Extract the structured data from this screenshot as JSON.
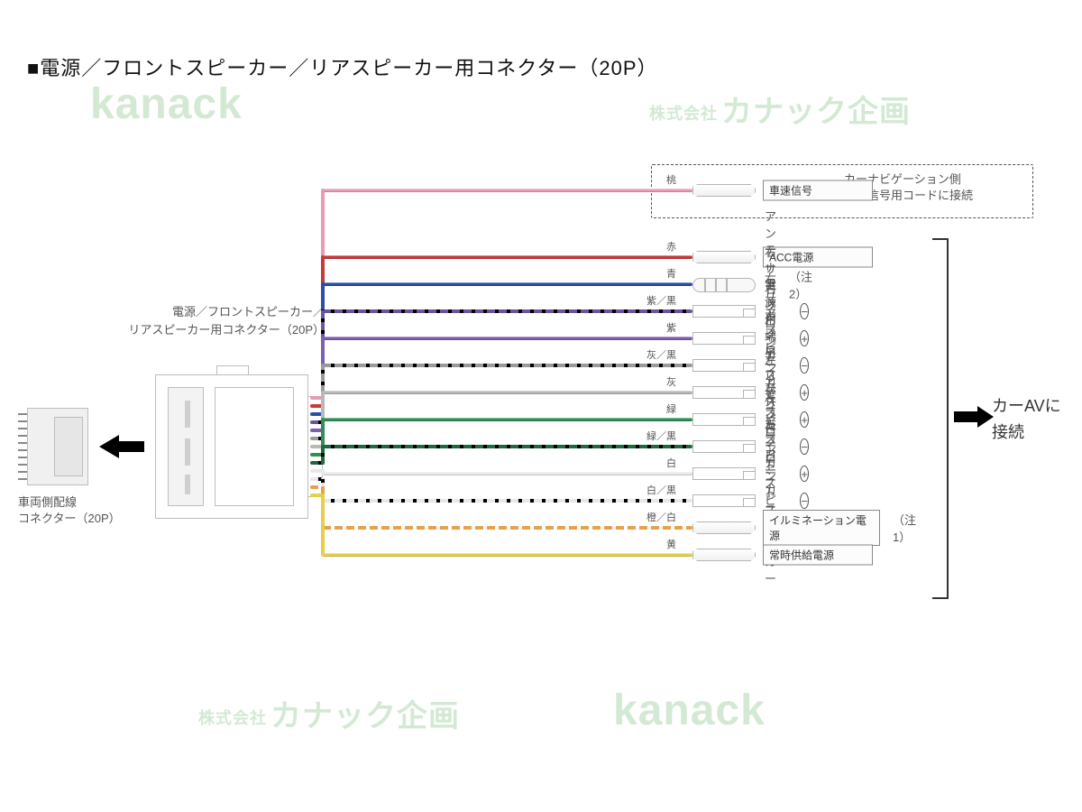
{
  "title": "■電源／フロントスピーカー／リアスピーカー用コネクター（20P）",
  "left": {
    "vehicle_conn_label_1": "車両側配線",
    "vehicle_conn_label_2": "コネクター（20P）",
    "main_conn_label_1": "電源／フロントスピーカー／",
    "main_conn_label_2": "リアスピーカー用コネクター（20P）"
  },
  "speed_signal": {
    "label": "車速信号",
    "dest_1": "カーナビゲーション側",
    "dest_2": "車速信号用コードに接続"
  },
  "right_group": {
    "line1": "カーAVに",
    "line2": "接続"
  },
  "notes": {
    "n1": "（注1）",
    "n2": "（注2）"
  },
  "wires": [
    {
      "id": "w_pink",
      "color_label": "桃",
      "css": "#e89ab6",
      "stripe": null,
      "plug": "A",
      "label_box": true,
      "label": "車速信号",
      "polarity": null,
      "note": null,
      "gap": true
    },
    {
      "id": "w_red",
      "color_label": "赤",
      "css": "#c63a3a",
      "stripe": null,
      "plug": "A",
      "label_box": true,
      "label": "ACC電源",
      "polarity": null,
      "note": null
    },
    {
      "id": "w_blue",
      "color_label": "青",
      "css": "#2b4ea8",
      "stripe": null,
      "plug": "C",
      "label_box": false,
      "label": "アンテナ電源用端子",
      "polarity": null,
      "note": "n2"
    },
    {
      "id": "w_pur_bk",
      "color_label": "紫／黒",
      "css": "#6a549c",
      "stripe": "#000",
      "plug": "B",
      "label_box": false,
      "label": "右リアスピーカー",
      "polarity": "⊖",
      "note": null
    },
    {
      "id": "w_pur",
      "color_label": "紫",
      "css": "#7d5fb0",
      "stripe": null,
      "plug": "B",
      "label_box": false,
      "label": "右リアスピーカー",
      "polarity": "⊕",
      "note": null
    },
    {
      "id": "w_gry_bk",
      "color_label": "灰／黒",
      "css": "#9a9a9a",
      "stripe": "#000",
      "plug": "B",
      "label_box": false,
      "label": "右フロントスピーカー",
      "polarity": "⊖",
      "note": null
    },
    {
      "id": "w_gry",
      "color_label": "灰",
      "css": "#b8b8b8",
      "stripe": null,
      "plug": "B",
      "label_box": false,
      "label": "右フロントスピーカー",
      "polarity": "⊕",
      "note": null
    },
    {
      "id": "w_grn",
      "color_label": "緑",
      "css": "#2f8f55",
      "stripe": null,
      "plug": "B",
      "label_box": false,
      "label": "左リアスピーカー",
      "polarity": "⊕",
      "note": null
    },
    {
      "id": "w_grn_bk",
      "color_label": "緑／黒",
      "css": "#1d6b3c",
      "stripe": "#000",
      "plug": "B",
      "label_box": false,
      "label": "左リアスピーカー",
      "polarity": "⊖",
      "note": null
    },
    {
      "id": "w_wht",
      "color_label": "白",
      "css": "#e8e8e8",
      "stripe": null,
      "plug": "B",
      "label_box": false,
      "label": "左フロントスピーカー",
      "polarity": "⊕",
      "note": null
    },
    {
      "id": "w_wht_bk",
      "color_label": "白／黒",
      "css": "#e8e8e8",
      "stripe": "#000",
      "plug": "B",
      "label_box": false,
      "label": "左フロントスピーカー",
      "polarity": "⊖",
      "note": null
    },
    {
      "id": "w_org_wh",
      "color_label": "橙／白",
      "css": "#e6a24a",
      "stripe": "#fff",
      "plug": "A",
      "label_box": true,
      "label": "イルミネーション電源",
      "polarity": null,
      "note": "n1"
    },
    {
      "id": "w_yel",
      "color_label": "黄",
      "css": "#e6cf4a",
      "stripe": null,
      "plug": "A",
      "label_box": true,
      "label": "常時供給電源",
      "polarity": null,
      "note": null
    }
  ],
  "watermarks": {
    "kanack": "kanack",
    "jp_prefix": "株式会社",
    "jp": "カナック企画"
  }
}
